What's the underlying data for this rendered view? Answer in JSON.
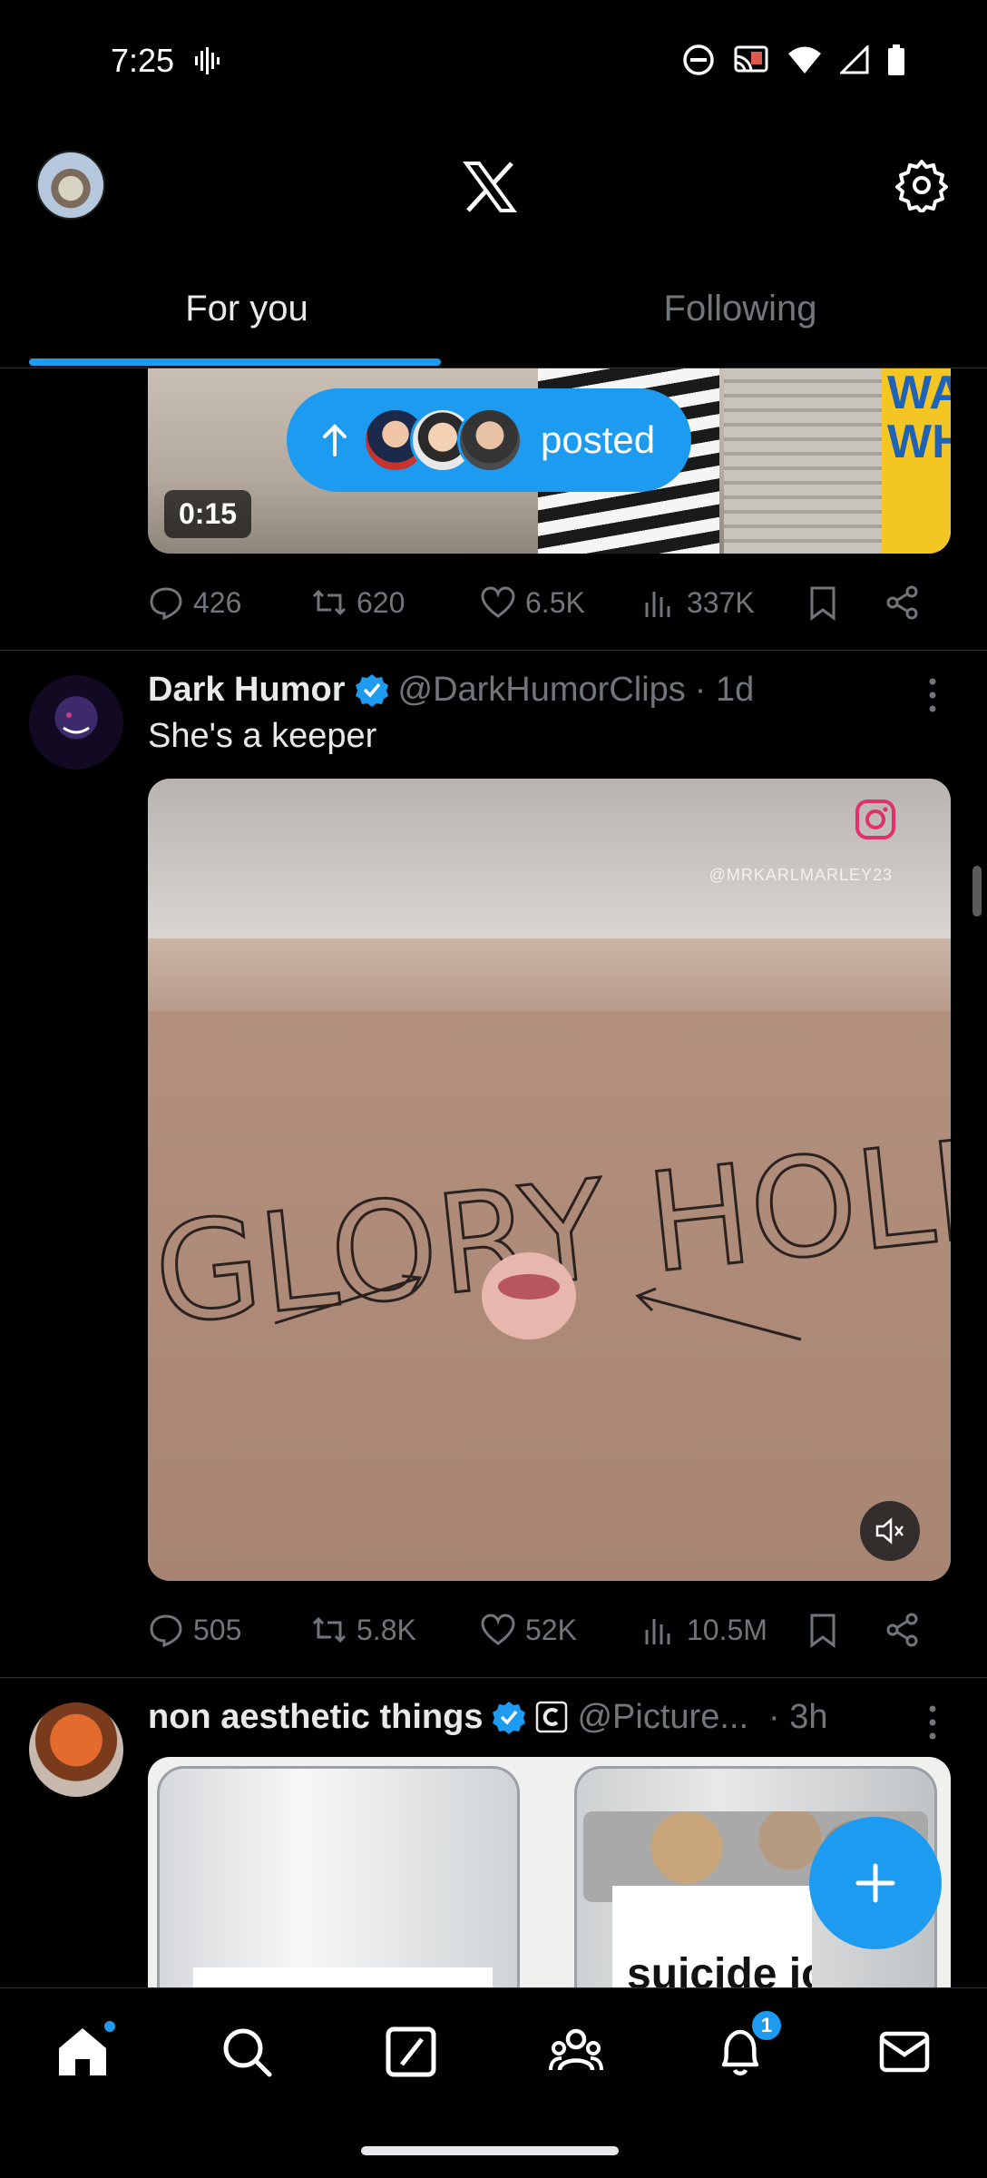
{
  "status_bar": {
    "time": "7:25"
  },
  "header": {
    "logo": "X"
  },
  "tabs": [
    {
      "label": "For you",
      "active": true
    },
    {
      "label": "Following",
      "active": false
    }
  ],
  "posted_pill": {
    "label": "posted"
  },
  "post1": {
    "video_duration": "0:15",
    "sign_text": "WA\nWH",
    "stats": {
      "replies": "426",
      "reposts": "620",
      "likes": "6.5K",
      "views": "337K"
    }
  },
  "post2": {
    "name": "Dark Humor",
    "handle": "@DarkHumorClips",
    "time": "· 1d",
    "text": "She's a keeper",
    "watermark": "@MRKARLMARLEY23",
    "media_caption": "GLORY HOLE",
    "stats": {
      "replies": "505",
      "reposts": "5.8K",
      "likes": "52K",
      "views": "10.5M"
    }
  },
  "post3": {
    "name": "non aesthetic things",
    "handle": "@Picture...",
    "time": "· 3h",
    "jar_label": "suicide joke"
  },
  "bottom_nav": {
    "notifications_count": "1"
  },
  "colors": {
    "accent": "#1d9bf0",
    "muted": "#71767b",
    "text": "#e7e9ea",
    "background": "#000000"
  }
}
